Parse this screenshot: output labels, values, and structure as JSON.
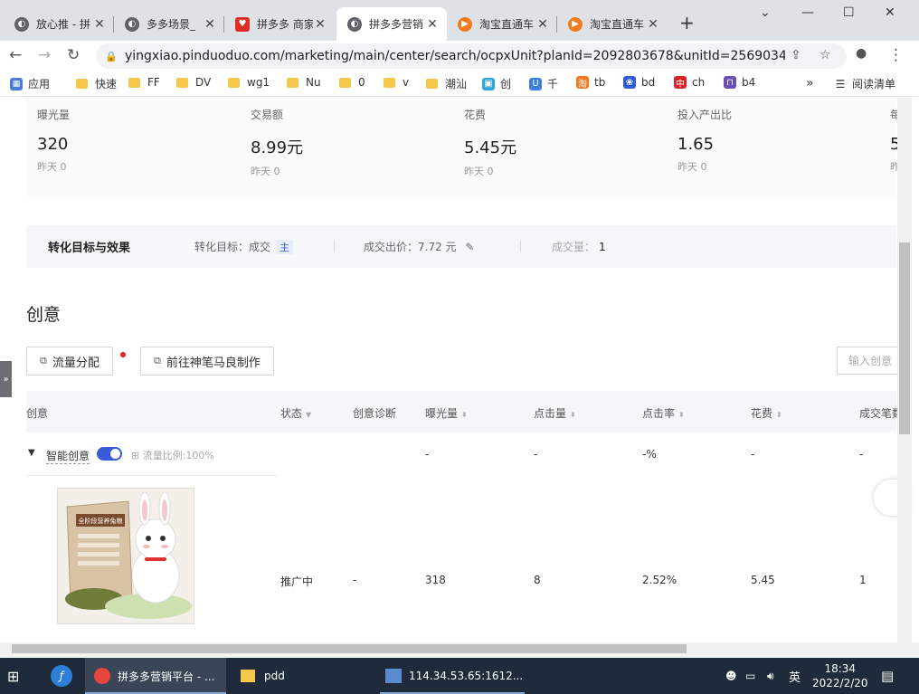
{
  "browser": {
    "tabs": [
      {
        "title": "放心推 - 拼",
        "color": "#5f6368"
      },
      {
        "title": "多多场景_",
        "color": "#5f6368"
      },
      {
        "title": "拼多多 商家",
        "color": "#e02e24"
      },
      {
        "title": "拼多多营销",
        "color": "#5f6368"
      },
      {
        "title": "淘宝直通车",
        "color": "#f47a20"
      },
      {
        "title": "淘宝直通车",
        "color": "#f47a20"
      }
    ],
    "url": "yingxiao.pinduoduo.com/marketing/main/center/search/ocpxUnit?planId=2092803678&unitId=25690344...",
    "bookmarks": [
      "应用",
      "快速",
      "FF",
      "DV",
      "wg1",
      "Nu",
      "0",
      "v",
      "潮汕",
      "创",
      "千",
      "tb",
      "bd",
      "ch",
      "b4"
    ],
    "reading_list": "阅读清单",
    "more": "»"
  },
  "metrics": [
    {
      "label": "曝光量",
      "value": "320",
      "yesterday": "昨天 0"
    },
    {
      "label": "交易额",
      "value": "8.99元",
      "yesterday": "昨天 0"
    },
    {
      "label": "花费",
      "value": "5.45元",
      "yesterday": "昨天 0"
    },
    {
      "label": "投入产出比",
      "value": "1.65",
      "yesterday": "昨天 0"
    },
    {
      "label": "每",
      "value": "5",
      "yesterday": "昨"
    }
  ],
  "conversion": {
    "title": "转化目标与效果",
    "goal": "转化目标：成交",
    "goal_tag": "主",
    "bid": "成交出价：7.72 元",
    "volume_label": "成交量：",
    "volume_value": "1"
  },
  "creative": {
    "section_title": "创意",
    "btn_traffic": "流量分配",
    "btn_make": "前往神笔马良制作",
    "search_placeholder": "输入创意",
    "columns": [
      "创意",
      "状态",
      "创意诊断",
      "曝光量",
      "点击量",
      "点击率",
      "花费",
      "成交笔数"
    ],
    "group": {
      "name": "智能创意",
      "ratio": "流量比例:100%",
      "impressions": "-",
      "clicks": "-",
      "ctr": "-%",
      "cost": "-",
      "orders": "-"
    },
    "row": {
      "status": "推广中",
      "diagnosis": "-",
      "impressions": "318",
      "clicks": "8",
      "ctr": "2.52%",
      "cost": "5.45",
      "orders": "1",
      "product_label": "全阶段营养兔粮"
    }
  },
  "taskbar": {
    "chrome": "拼多多营销平台 - ...",
    "folder": "pdd",
    "remote": "114.34.53.65:1612...",
    "ime": "英",
    "time": "18:34",
    "date": "2022/2/20"
  }
}
